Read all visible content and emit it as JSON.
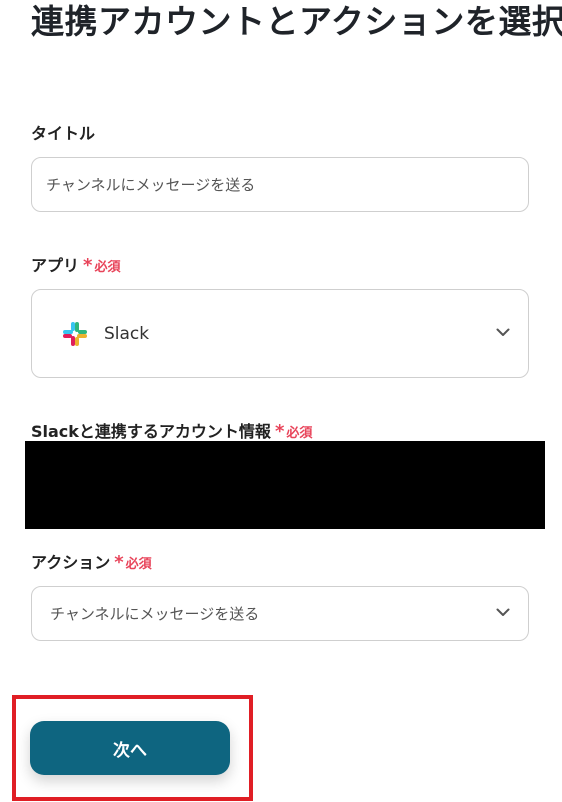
{
  "page": {
    "title": "連携アカウントとアクションを選択"
  },
  "fields": {
    "title_label": "タイトル",
    "title_value": "チャンネルにメッセージを送る",
    "app_label": "アプリ",
    "app_value": "Slack",
    "account_label": "Slackと連携するアカウント情報",
    "action_label": "アクション",
    "action_value": "チャンネルにメッセージを送る",
    "required_star": "*",
    "required_text": "必須"
  },
  "buttons": {
    "next_label": "次へ"
  },
  "icons": {
    "app_icon": "slack-logo-icon",
    "select_chevron": "chevron-down-icon"
  },
  "colors": {
    "primary_button": "#0e6580",
    "required": "#e8445a",
    "highlight": "#e01e25",
    "redaction": "#000000"
  }
}
